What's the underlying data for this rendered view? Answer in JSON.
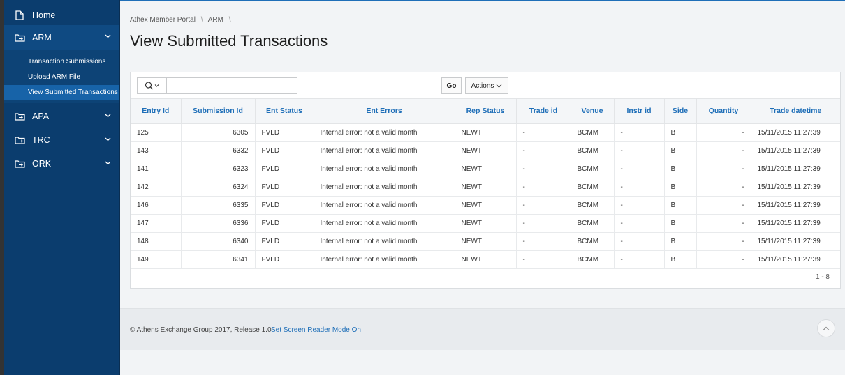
{
  "nav": {
    "home": "Home",
    "arm": "ARM",
    "arm_sub": [
      "Transaction Submissions",
      "Upload ARM File",
      "View Submitted Transactions"
    ],
    "apa": "APA",
    "trc": "TRC",
    "ork": "ORK"
  },
  "breadcrumb": {
    "item1": "Athex Member Portal",
    "item2": "ARM",
    "sep": "\\"
  },
  "page_title": "View Submitted Transactions",
  "toolbar": {
    "search_value": "",
    "go_label": "Go",
    "actions_label": "Actions"
  },
  "table": {
    "columns": [
      "Entry Id",
      "Submission Id",
      "Ent Status",
      "Ent Errors",
      "Rep Status",
      "Trade id",
      "Venue",
      "Instr id",
      "Side",
      "Quantity",
      "Trade datetime"
    ],
    "rows": [
      [
        "125",
        "6305",
        "FVLD",
        "Internal error: not a valid month",
        "NEWT",
        "-",
        "BCMM",
        "-",
        "B",
        "-",
        "15/11/2015 11:27:39"
      ],
      [
        "143",
        "6332",
        "FVLD",
        "Internal error: not a valid month",
        "NEWT",
        "-",
        "BCMM",
        "-",
        "B",
        "-",
        "15/11/2015 11:27:39"
      ],
      [
        "141",
        "6323",
        "FVLD",
        "Internal error: not a valid month",
        "NEWT",
        "-",
        "BCMM",
        "-",
        "B",
        "-",
        "15/11/2015 11:27:39"
      ],
      [
        "142",
        "6324",
        "FVLD",
        "Internal error: not a valid month",
        "NEWT",
        "-",
        "BCMM",
        "-",
        "B",
        "-",
        "15/11/2015 11:27:39"
      ],
      [
        "146",
        "6335",
        "FVLD",
        "Internal error: not a valid month",
        "NEWT",
        "-",
        "BCMM",
        "-",
        "B",
        "-",
        "15/11/2015 11:27:39"
      ],
      [
        "147",
        "6336",
        "FVLD",
        "Internal error: not a valid month",
        "NEWT",
        "-",
        "BCMM",
        "-",
        "B",
        "-",
        "15/11/2015 11:27:39"
      ],
      [
        "148",
        "6340",
        "FVLD",
        "Internal error: not a valid month",
        "NEWT",
        "-",
        "BCMM",
        "-",
        "B",
        "-",
        "15/11/2015 11:27:39"
      ],
      [
        "149",
        "6341",
        "FVLD",
        "Internal error: not a valid month",
        "NEWT",
        "-",
        "BCMM",
        "-",
        "B",
        "-",
        "15/11/2015 11:27:39"
      ]
    ]
  },
  "pagination": "1 - 8",
  "footer": {
    "copyright": "© Athens Exchange Group 2017, Release 1.0",
    "link": "Set Screen Reader Mode On"
  },
  "colors": {
    "sidebar": "#0b3d6e",
    "accent": "#1f6fb8",
    "active": "#1763a8"
  },
  "icons": {
    "home": "page-icon",
    "section": "folder-arrow-icon",
    "expand": "chevron-down-icon",
    "search": "search-icon",
    "top": "chevron-up-icon"
  }
}
